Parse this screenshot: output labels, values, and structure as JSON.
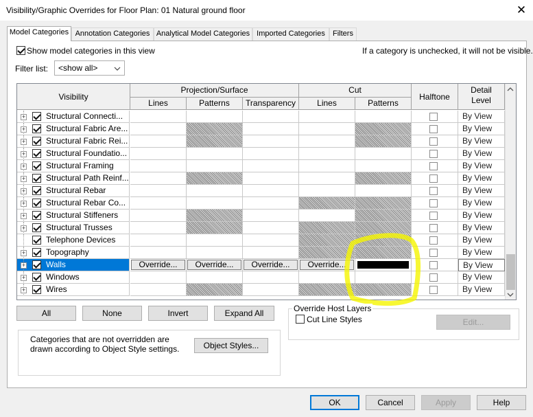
{
  "window": {
    "title": "Visibility/Graphic Overrides for Floor Plan: 01 Natural ground floor",
    "close_glyph": "✕"
  },
  "tabs": [
    {
      "label": "Model Categories",
      "active": true
    },
    {
      "label": "Annotation Categories"
    },
    {
      "label": "Analytical Model Categories"
    },
    {
      "label": "Imported Categories"
    },
    {
      "label": "Filters"
    }
  ],
  "show_model_categories": {
    "label": "Show model categories in this view",
    "checked": true
  },
  "unchecked_note": "If a category is unchecked, it will not be visible.",
  "filter_list": {
    "label": "Filter list:",
    "value": "<show all>"
  },
  "table": {
    "headers": {
      "visibility": "Visibility",
      "projection_surface": "Projection/Surface",
      "cut": "Cut",
      "halftone": "Halftone",
      "detail_level": "Detail Level",
      "lines": "Lines",
      "patterns": "Patterns",
      "transparency": "Transparency",
      "cut_lines": "Lines",
      "cut_patterns": "Patterns"
    },
    "rows": [
      {
        "name": "Structural Connecti...",
        "expandable": true,
        "checked": true,
        "detail": "By View"
      },
      {
        "name": "Structural Fabric Are...",
        "expandable": true,
        "checked": true,
        "detail": "By View"
      },
      {
        "name": "Structural Fabric Rei...",
        "expandable": true,
        "checked": true,
        "detail": "By View"
      },
      {
        "name": "Structural Foundatio...",
        "expandable": true,
        "checked": true,
        "detail": "By View"
      },
      {
        "name": "Structural Framing",
        "expandable": true,
        "checked": true,
        "detail": "By View"
      },
      {
        "name": "Structural Path Reinf...",
        "expandable": true,
        "checked": true,
        "detail": "By View"
      },
      {
        "name": "Structural Rebar",
        "expandable": true,
        "checked": true,
        "detail": "By View"
      },
      {
        "name": "Structural Rebar Co...",
        "expandable": true,
        "checked": true,
        "detail": "By View"
      },
      {
        "name": "Structural Stiffeners",
        "expandable": true,
        "checked": true,
        "detail": "By View"
      },
      {
        "name": "Structural Trusses",
        "expandable": true,
        "checked": true,
        "detail": "By View"
      },
      {
        "name": "Telephone Devices",
        "expandable": false,
        "checked": true,
        "detail": "By View"
      },
      {
        "name": "Topography",
        "expandable": true,
        "checked": true,
        "detail": "By View"
      },
      {
        "name": "Walls",
        "expandable": true,
        "checked": true,
        "detail": "By View",
        "selected": true,
        "override_label": "Override..."
      },
      {
        "name": "Windows",
        "expandable": true,
        "checked": true,
        "detail": "By View"
      },
      {
        "name": "Wires",
        "expandable": true,
        "checked": true,
        "detail": "By View"
      }
    ]
  },
  "buttons": {
    "all": "All",
    "none": "None",
    "invert": "Invert",
    "expand_all": "Expand All",
    "object_styles": "Object Styles...",
    "edit": "Edit...",
    "ok": "OK",
    "cancel": "Cancel",
    "apply": "Apply",
    "help": "Help"
  },
  "override_host_layers": {
    "title": "Override Host Layers",
    "cut_line_styles": "Cut Line Styles",
    "checked": false
  },
  "note_text": "Categories that are not overridden are drawn according to Object Style settings.",
  "annotation": {
    "highlight_color": "#f5f500"
  }
}
